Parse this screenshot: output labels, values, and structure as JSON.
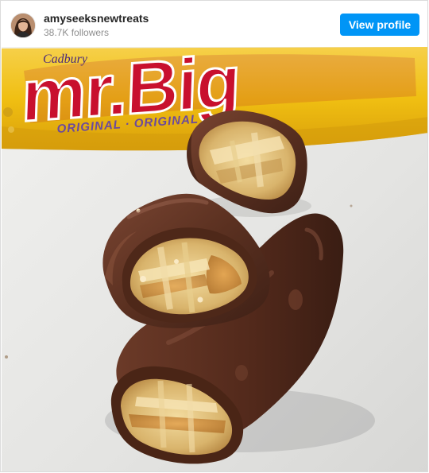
{
  "header": {
    "username": "amyseeksnewtreats",
    "followers": "38.7K followers",
    "view_profile_label": "View profile"
  },
  "post": {
    "wrapper_brand_text": "mr.Big",
    "wrapper_sub_text": "ORIGINAL · ORIGINAL",
    "wrapper_logo_text": "Cadbury"
  },
  "colors": {
    "button_blue": "#0095f6",
    "wrapper_yellow": "#f2c31a",
    "wrapper_red": "#c8102e",
    "chocolate": "#5a3020"
  }
}
